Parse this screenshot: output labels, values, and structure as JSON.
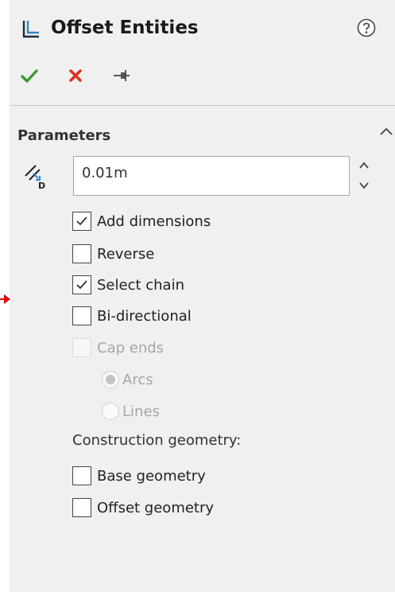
{
  "header": {
    "title": "Offset Entities"
  },
  "icons": {
    "feature": "offset-entities-icon",
    "help": "help-icon",
    "ok": "check-icon",
    "cancel": "close-icon",
    "pin": "pushpin-icon",
    "collapse": "chevron-up-icon",
    "distance": "offset-distance-icon"
  },
  "colors": {
    "ok": "#3a9a2e",
    "cancel": "#e02b1e",
    "arrow": "#e00000"
  },
  "parameters": {
    "title": "Parameters",
    "distance_value": "0.01m",
    "options": [
      {
        "label": "Add dimensions",
        "checked": true
      },
      {
        "label": "Reverse",
        "checked": false
      },
      {
        "label": "Select chain",
        "checked": true
      },
      {
        "label": "Bi-directional",
        "checked": false
      },
      {
        "label": "Cap ends",
        "checked": false,
        "disabled": true
      }
    ],
    "cap_types": [
      {
        "label": "Arcs",
        "selected": true,
        "disabled": true
      },
      {
        "label": "Lines",
        "selected": false,
        "disabled": true
      }
    ],
    "construction_label": "Construction geometry:",
    "construction": [
      {
        "label": "Base geometry",
        "checked": false
      },
      {
        "label": "Offset geometry",
        "checked": false
      }
    ]
  }
}
